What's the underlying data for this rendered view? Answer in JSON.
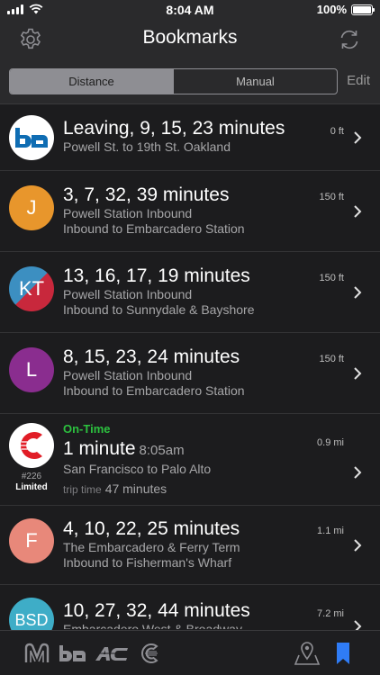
{
  "status_bar": {
    "time": "8:04 AM",
    "battery": "100%"
  },
  "nav": {
    "title": "Bookmarks",
    "settings_icon": "gear-icon",
    "refresh_icon": "refresh-icon"
  },
  "segmented": {
    "options": [
      "Distance",
      "Manual"
    ],
    "selected": "Distance",
    "edit_label": "Edit"
  },
  "rows": [
    {
      "badge": "ba",
      "badge_color": "#ffffff",
      "headline": "Leaving, 9, 15, 23 minutes",
      "line1": "Powell St. to 19th St. Oakland",
      "distance": "0 ft"
    },
    {
      "badge": "J",
      "badge_color": "#e8962c",
      "headline": "3, 7, 32, 39 minutes",
      "line1": "Powell Station Inbound",
      "line2": "Inbound to Embarcadero Station",
      "distance": "150 ft"
    },
    {
      "badge": "KT",
      "badge_color": "#3c8fc1",
      "badge_color2": "#c8283c",
      "headline": "13, 16, 17, 19 minutes",
      "line1": "Powell Station Inbound",
      "line2": "Inbound to Sunnydale & Bayshore",
      "distance": "150 ft"
    },
    {
      "badge": "L",
      "badge_color": "#8a2d8f",
      "headline": "8, 15, 23, 24 minutes",
      "line1": "Powell Station Inbound",
      "line2": "Inbound to Embarcadero Station",
      "distance": "150 ft"
    },
    {
      "badge": "C",
      "badge_color": "#ffffff",
      "badge_accent": "#e11d26",
      "status": "On-Time",
      "headline": "1 minute",
      "time": "8:05am",
      "line1": "San Francisco to Palo Alto",
      "trip_label": "trip time",
      "trip_value": "47 minutes",
      "train_number": "#226",
      "train_kind": "Limited",
      "distance": "0.9 mi"
    },
    {
      "badge": "F",
      "badge_color": "#e8887a",
      "headline": "4, 10, 22, 25 minutes",
      "line1": "The Embarcadero & Ferry Term",
      "line2": "Inbound to Fisherman's Wharf",
      "distance": "1.1 mi"
    },
    {
      "badge": "BSD",
      "badge_color": "#3eadc7",
      "headline": "10, 27, 32, 44 minutes",
      "line1": "Embarcadero West & Broadway",
      "distance": "7.2 mi"
    }
  ],
  "tabs": [
    {
      "name": "muni-tab",
      "icon": "muni-logo-icon"
    },
    {
      "name": "bart-tab",
      "icon": "bart-logo-icon"
    },
    {
      "name": "ac-transit-tab",
      "icon": "ac-transit-logo-icon"
    },
    {
      "name": "caltrain-tab",
      "icon": "caltrain-logo-icon"
    },
    {
      "name": "map-tab",
      "icon": "map-pin-icon"
    },
    {
      "name": "bookmarks-tab",
      "icon": "bookmark-icon",
      "active_color": "#2f7cf6"
    }
  ]
}
